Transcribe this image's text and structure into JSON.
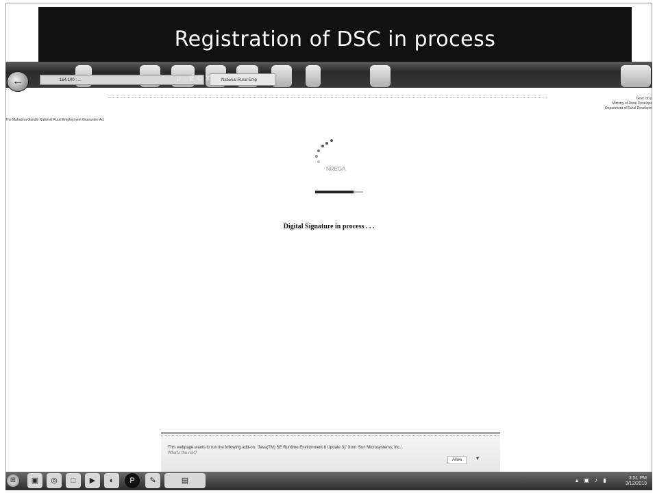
{
  "slide": {
    "title": "Registration of DSC in process"
  },
  "browser": {
    "address": "164.100 : ...",
    "address_icons": "ρ · Ɇ C X",
    "tab_title": "National Rural Emp"
  },
  "page": {
    "header_left": "The Mahatma Gandhi National Rural Employment Guarantee Act",
    "gov_lines": [
      "Govt. of In",
      "Ministry of Rural Develope",
      "Department of Rural Developm"
    ],
    "logo_text": "NREGA",
    "status_message": "Digital Signature in process . . ."
  },
  "notification": {
    "message": "This webpage wants to run the following add-on: 'Java(TM) SE Runtime Environment 6 Update 31' from 'Sun Microsystems, Inc.'.",
    "risk_link": "What's the risk?",
    "allow_label": "Allow",
    "chevron": "▾"
  },
  "taskbar": {
    "start_icon": "start-orb-icon",
    "clock_time": "3:51 PM",
    "clock_date": "3/12/2013",
    "tray_icons": "▴ ▣ ♪ ▮"
  }
}
